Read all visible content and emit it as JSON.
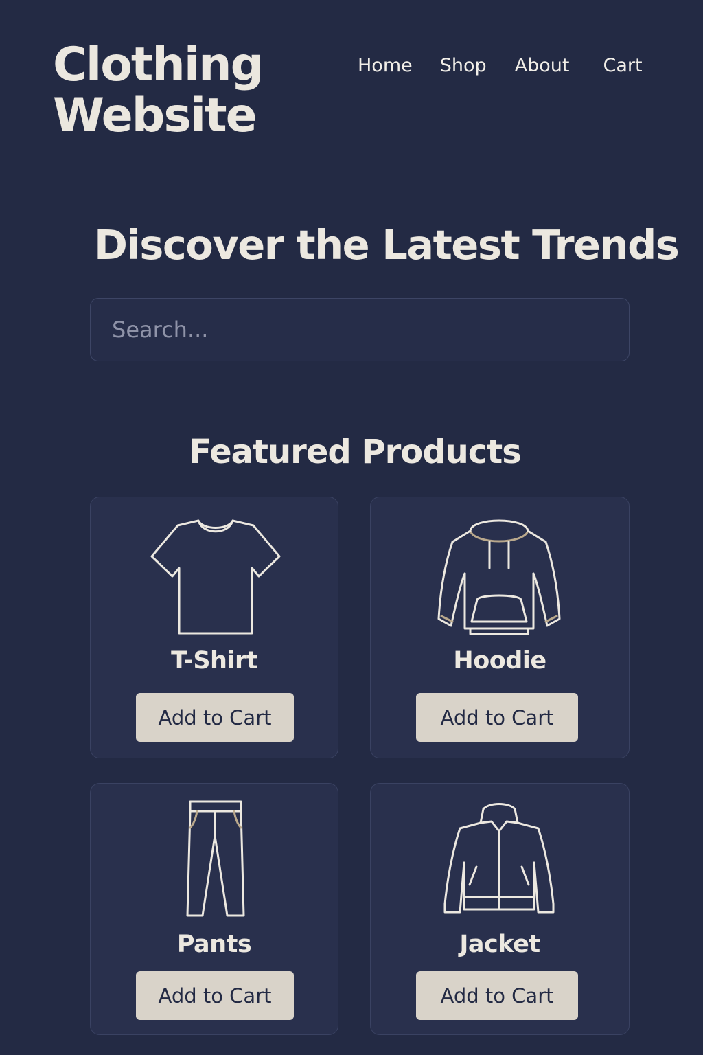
{
  "site": {
    "logo_line1": "Clothing",
    "logo_line2": "Website"
  },
  "nav": {
    "items": [
      {
        "label": "Home"
      },
      {
        "label": "Shop"
      },
      {
        "label": "About"
      },
      {
        "label": "Cart"
      }
    ]
  },
  "hero": {
    "title": "Discover the Latest Trends"
  },
  "search": {
    "placeholder": "Search..."
  },
  "featured": {
    "title": "Featured Products",
    "products": [
      {
        "name": "T-Shirt",
        "icon": "tshirt-icon",
        "button_label": "Add to Cart"
      },
      {
        "name": "Hoodie",
        "icon": "hoodie-icon",
        "button_label": "Add to Cart"
      },
      {
        "name": "Pants",
        "icon": "pants-icon",
        "button_label": "Add to Cart"
      },
      {
        "name": "Jacket",
        "icon": "jacket-icon",
        "button_label": "Add to Cart"
      }
    ]
  },
  "colors": {
    "background": "#232a44",
    "card": "#29304d",
    "text": "#ece8e0",
    "button": "#d9d3c9",
    "accent_tan": "#b9a88c"
  }
}
